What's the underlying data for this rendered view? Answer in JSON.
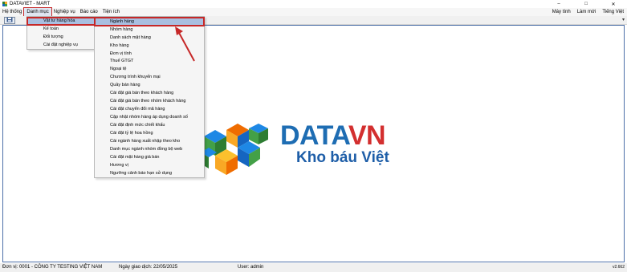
{
  "window": {
    "title": "DATAVIET - MART",
    "controls": [
      "–",
      "□",
      "✕"
    ]
  },
  "menubar": {
    "items": [
      "Hệ thống",
      "Danh mục",
      "Nghiệp vụ",
      "Báo cáo",
      "Tiện ích"
    ],
    "right_items": [
      "Máy tính",
      "Làm mới",
      "Tiếng Việt"
    ]
  },
  "toolbar": {
    "chevron": "▾"
  },
  "danh_muc_menu": {
    "items": [
      {
        "label": "Vật tư hàng hóa",
        "arrow": "▸"
      },
      {
        "label": "Kế toán",
        "arrow": "▸"
      },
      {
        "label": "Đối tượng",
        "arrow": "▸"
      },
      {
        "label": "Cài đặt nghiệp vụ",
        "arrow": "▸"
      }
    ]
  },
  "vat_tu_submenu": {
    "items": [
      "Ngành hàng",
      "Nhóm hàng",
      "Danh sách mặt hàng",
      "Kho hàng",
      "Đơn vị tính",
      "Thuế GTGT",
      "Ngoại tệ",
      "Chương trình khuyến mại",
      "Quầy bán hàng",
      "Cài đặt giá bán theo khách hàng",
      "Cài đặt giá bán theo nhóm khách hàng",
      "Cài đặt chuyển đổi mã hàng",
      "Cập nhật nhóm hàng áp dụng doanh số",
      "Cài đặt định mức chiết khấu",
      "Cài đặt tỷ lệ hoa hồng",
      "Cài ngành hàng xuất nhập theo kho",
      "Danh mục ngành nhóm đồng bộ web",
      "Cài đặt mặt hàng giá bán",
      "Hương vị",
      "Ngưỡng cảnh báo hạn sử dụng"
    ]
  },
  "logo": {
    "brand_data": "DATA",
    "brand_vn": "VN",
    "slogan": "Kho báu Việt"
  },
  "statusbar": {
    "unit": "Đơn vị: 0001 - CÔNG TY TESTING VIỆT NAM",
    "date": "Ngày giao dịch: 22/05/2025",
    "user": "User: admin",
    "version": "v2.662"
  },
  "colors": {
    "menu_highlight": "#a9bfe0",
    "annotation_red": "#c62828",
    "brand_blue": "#1e6db3",
    "brand_red": "#d32f2f"
  }
}
